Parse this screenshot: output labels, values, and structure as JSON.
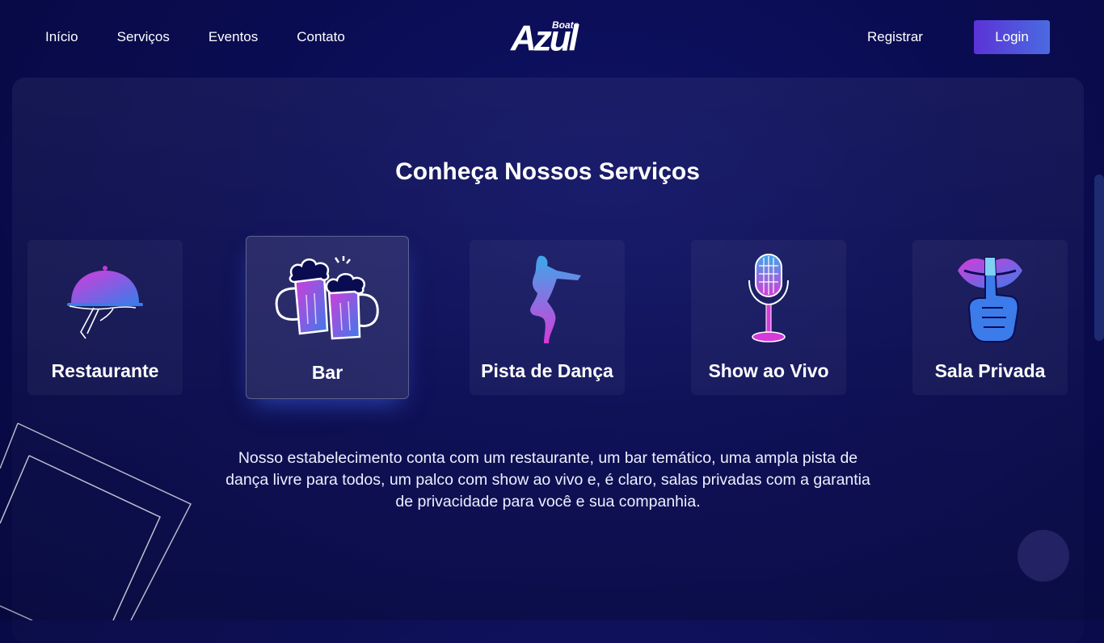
{
  "nav": {
    "items": [
      "Início",
      "Serviços",
      "Eventos",
      "Contato"
    ]
  },
  "logo": {
    "small": "Boate",
    "big": "Azul"
  },
  "header": {
    "register_label": "Registrar",
    "login_label": "Login"
  },
  "services": {
    "title": "Conheça Nossos Serviços",
    "items": [
      {
        "label": "Restaurante",
        "icon": "cloche-icon"
      },
      {
        "label": "Bar",
        "icon": "beer-mugs-icon"
      },
      {
        "label": "Pista de Dança",
        "icon": "dancer-icon"
      },
      {
        "label": "Show ao Vivo",
        "icon": "microphone-icon"
      },
      {
        "label": "Sala Privada",
        "icon": "shush-lips-icon"
      }
    ],
    "active_index": 1,
    "description": "Nosso estabelecimento conta com um restaurante, um bar temático, uma ampla pista de dança livre para todos, um palco com show ao vivo e, é claro, salas privadas com a garantia de privacidade para você e sua companhia."
  },
  "colors": {
    "accent_start": "#5b33d6",
    "accent_end": "#4a6be0",
    "icon_pink": "#d63bd9",
    "icon_blue": "#3b7bea",
    "background": "#0a0c52"
  }
}
